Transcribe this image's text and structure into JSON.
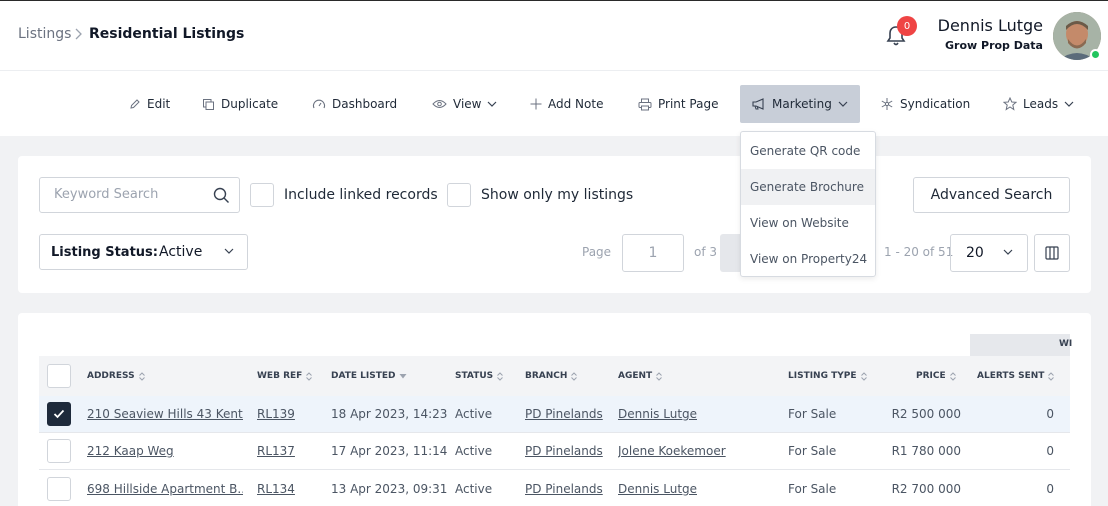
{
  "breadcrumb": {
    "root": "Listings",
    "current": "Residential Listings"
  },
  "notifications": {
    "count": "0"
  },
  "user": {
    "name": "Dennis Lutge",
    "org": "Grow Prop Data"
  },
  "toolbar": {
    "edit": "Edit",
    "duplicate": "Duplicate",
    "dashboard": "Dashboard",
    "view": "View",
    "add_note": "Add Note",
    "print_page": "Print Page",
    "marketing": "Marketing",
    "syndication": "Syndication",
    "leads": "Leads"
  },
  "marketing_menu": [
    "Generate QR code",
    "Generate Brochure",
    "View on Website",
    "View on Property24"
  ],
  "filters": {
    "search_placeholder": "Keyword Search",
    "include_linked": "Include linked records",
    "only_mine": "Show only my listings",
    "advanced_search": "Advanced Search",
    "status_label": "Listing Status:",
    "status_value": "Active"
  },
  "pagination": {
    "page_label": "Page",
    "page_value": "1",
    "of_label": "of 3",
    "range": "1 - 20 of 51",
    "per_page": "20"
  },
  "table": {
    "group_header": "WI",
    "columns": {
      "address": "ADDRESS",
      "web_ref": "WEB REF",
      "date_listed": "DATE LISTED",
      "status": "STATUS",
      "branch": "BRANCH",
      "agent": "AGENT",
      "listing_type": "LISTING TYPE",
      "price": "PRICE",
      "alerts_sent": "ALERTS SENT"
    },
    "rows": [
      {
        "address": "210 Seaview Hills 43 Kent...",
        "web_ref": "RL139",
        "date": "18 Apr 2023, 14:23",
        "status": "Active",
        "branch": "PD Pinelands",
        "agent": "Dennis Lutge",
        "type": "For Sale",
        "price": "R2 500 000",
        "alerts": "0"
      },
      {
        "address": "212 Kaap Weg",
        "web_ref": "RL137",
        "date": "17 Apr 2023, 11:14",
        "status": "Active",
        "branch": "PD Pinelands",
        "agent": "Jolene Koekemoer",
        "type": "For Sale",
        "price": "R1 780 000",
        "alerts": "0"
      },
      {
        "address": "698 Hillside Apartment B...",
        "web_ref": "RL134",
        "date": "13 Apr 2023, 09:31",
        "status": "Active",
        "branch": "PD Pinelands",
        "agent": "Dennis Lutge",
        "type": "For Sale",
        "price": "R2 700 000",
        "alerts": "0"
      }
    ]
  }
}
